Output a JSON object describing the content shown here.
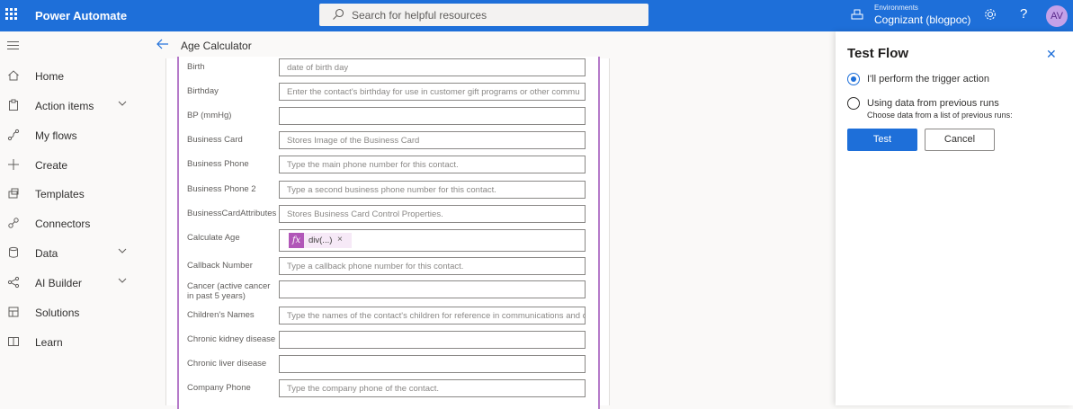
{
  "app": {
    "name": "Power Automate"
  },
  "search": {
    "placeholder": "Search for helpful resources"
  },
  "environment": {
    "label": "Environments",
    "name": "Cognizant (blogpoc)"
  },
  "user": {
    "initials": "AV"
  },
  "help": {
    "label": "?"
  },
  "nav": {
    "items": [
      {
        "label": "Home",
        "icon": "home-icon"
      },
      {
        "label": "Action items",
        "icon": "clipboard-icon",
        "expandable": true
      },
      {
        "label": "My flows",
        "icon": "flow-icon"
      },
      {
        "label": "Create",
        "icon": "plus-icon"
      },
      {
        "label": "Templates",
        "icon": "templates-icon"
      },
      {
        "label": "Connectors",
        "icon": "connectors-icon"
      },
      {
        "label": "Data",
        "icon": "database-icon",
        "expandable": true
      },
      {
        "label": "AI Builder",
        "icon": "ai-builder-icon",
        "expandable": true
      },
      {
        "label": "Solutions",
        "icon": "solutions-icon"
      },
      {
        "label": "Learn",
        "icon": "book-icon"
      }
    ]
  },
  "breadcrumb": {
    "title": "Age Calculator"
  },
  "form": {
    "fields": [
      {
        "label": "Birth",
        "placeholder": "date of birth day"
      },
      {
        "label": "Birthday",
        "placeholder": "Enter the contact's birthday for use in customer gift programs or other commu"
      },
      {
        "label": "BP (mmHg)",
        "placeholder": ""
      },
      {
        "label": "Business Card",
        "placeholder": "Stores Image of the Business Card"
      },
      {
        "label": "Business Phone",
        "placeholder": "Type the main phone number for this contact."
      },
      {
        "label": "Business Phone 2",
        "placeholder": "Type a second business phone number for this contact."
      },
      {
        "label": "BusinessCardAttributes",
        "placeholder": "Stores Business Card Control Properties."
      },
      {
        "label": "Calculate Age",
        "token": {
          "icon": "fx",
          "label": "div(...)",
          "close": "×"
        }
      },
      {
        "label": "Callback Number",
        "placeholder": "Type a callback phone number for this contact."
      },
      {
        "label": "Cancer (active cancer in past 5 years)",
        "placeholder": ""
      },
      {
        "label": "Children's Names",
        "placeholder": "Type the names of the contact's children for reference in communications and c"
      },
      {
        "label": "Chronic kidney disease",
        "placeholder": ""
      },
      {
        "label": "Chronic liver disease",
        "placeholder": ""
      },
      {
        "label": "Company Phone",
        "placeholder": "Type the company phone of the contact."
      }
    ]
  },
  "test_panel": {
    "title": "Test Flow",
    "close": "✕",
    "options": [
      {
        "label": "I'll perform the trigger action",
        "selected": true
      },
      {
        "label": "Using data from previous runs",
        "sub": "Choose data from a list of previous runs:",
        "selected": false
      }
    ],
    "test_label": "Test",
    "cancel_label": "Cancel"
  },
  "colors": {
    "brand": "#1e6fd9",
    "accent": "#b157b8"
  }
}
